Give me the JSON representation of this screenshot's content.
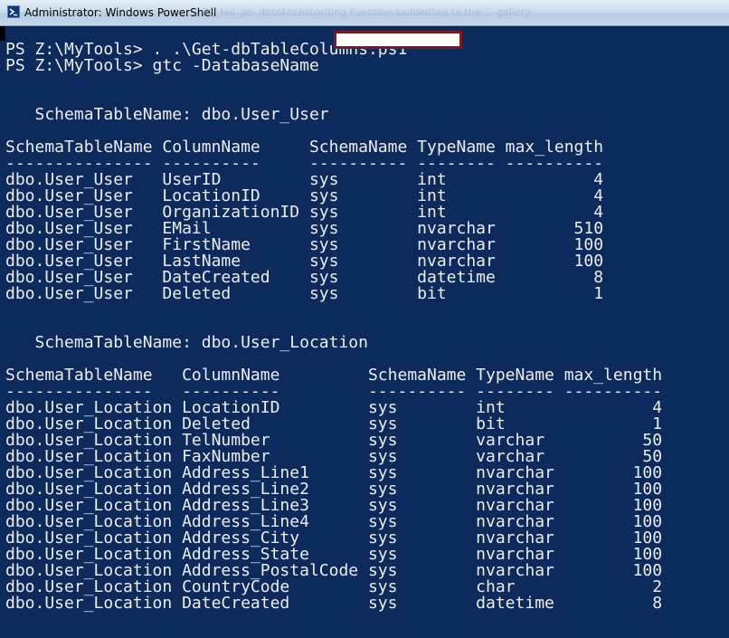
{
  "window": {
    "title": "Administrator: Windows PowerShell",
    "title_ghost": "... PS_fail_ge. doc/Ancestor/ting Function saddeitted to the ... gallery",
    "icon": "powershell-icon",
    "colors": {
      "console_bg": "#0c2a5c",
      "console_fg": "#eeedf0",
      "redaction_border": "#7b1a22"
    }
  },
  "console": {
    "prompt1": "PS Z:\\MyTools> . .\\Get-dbTableColumns.ps1",
    "prompt2": "PS Z:\\MyTools> gtc -DatabaseName",
    "tables": [
      {
        "group_header": "   SchemaTableName: dbo.User_User",
        "header": "SchemaTableName ColumnName     SchemaName TypeName max_length",
        "separator": "--------------- ----------     ---------- -------- ----------",
        "rows": [
          "dbo.User_User   UserID         sys        int               4",
          "dbo.User_User   LocationID     sys        int               4",
          "dbo.User_User   OrganizationID sys        int               4",
          "dbo.User_User   EMail          sys        nvarchar        510",
          "dbo.User_User   FirstName      sys        nvarchar        100",
          "dbo.User_User   LastName       sys        nvarchar        100",
          "dbo.User_User   DateCreated    sys        datetime          8",
          "dbo.User_User   Deleted        sys        bit               1"
        ]
      },
      {
        "group_header": "   SchemaTableName: dbo.User_Location",
        "header": "SchemaTableName   ColumnName         SchemaName TypeName max_length",
        "separator": "---------------   ----------         ---------- -------- ----------",
        "rows": [
          "dbo.User_Location LocationID         sys        int               4",
          "dbo.User_Location Deleted            sys        bit               1",
          "dbo.User_Location TelNumber          sys        varchar          50",
          "dbo.User_Location FaxNumber          sys        varchar          50",
          "dbo.User_Location Address_Line1      sys        nvarchar        100",
          "dbo.User_Location Address_Line2      sys        nvarchar        100",
          "dbo.User_Location Address_Line3      sys        nvarchar        100",
          "dbo.User_Location Address_Line4      sys        nvarchar        100",
          "dbo.User_Location Address_City       sys        nvarchar        100",
          "dbo.User_Location Address_State      sys        nvarchar        100",
          "dbo.User_Location Address_PostalCode sys        nvarchar        100",
          "dbo.User_Location CountryCode        sys        char              2",
          "dbo.User_Location DateCreated        sys        datetime          8"
        ]
      }
    ]
  }
}
